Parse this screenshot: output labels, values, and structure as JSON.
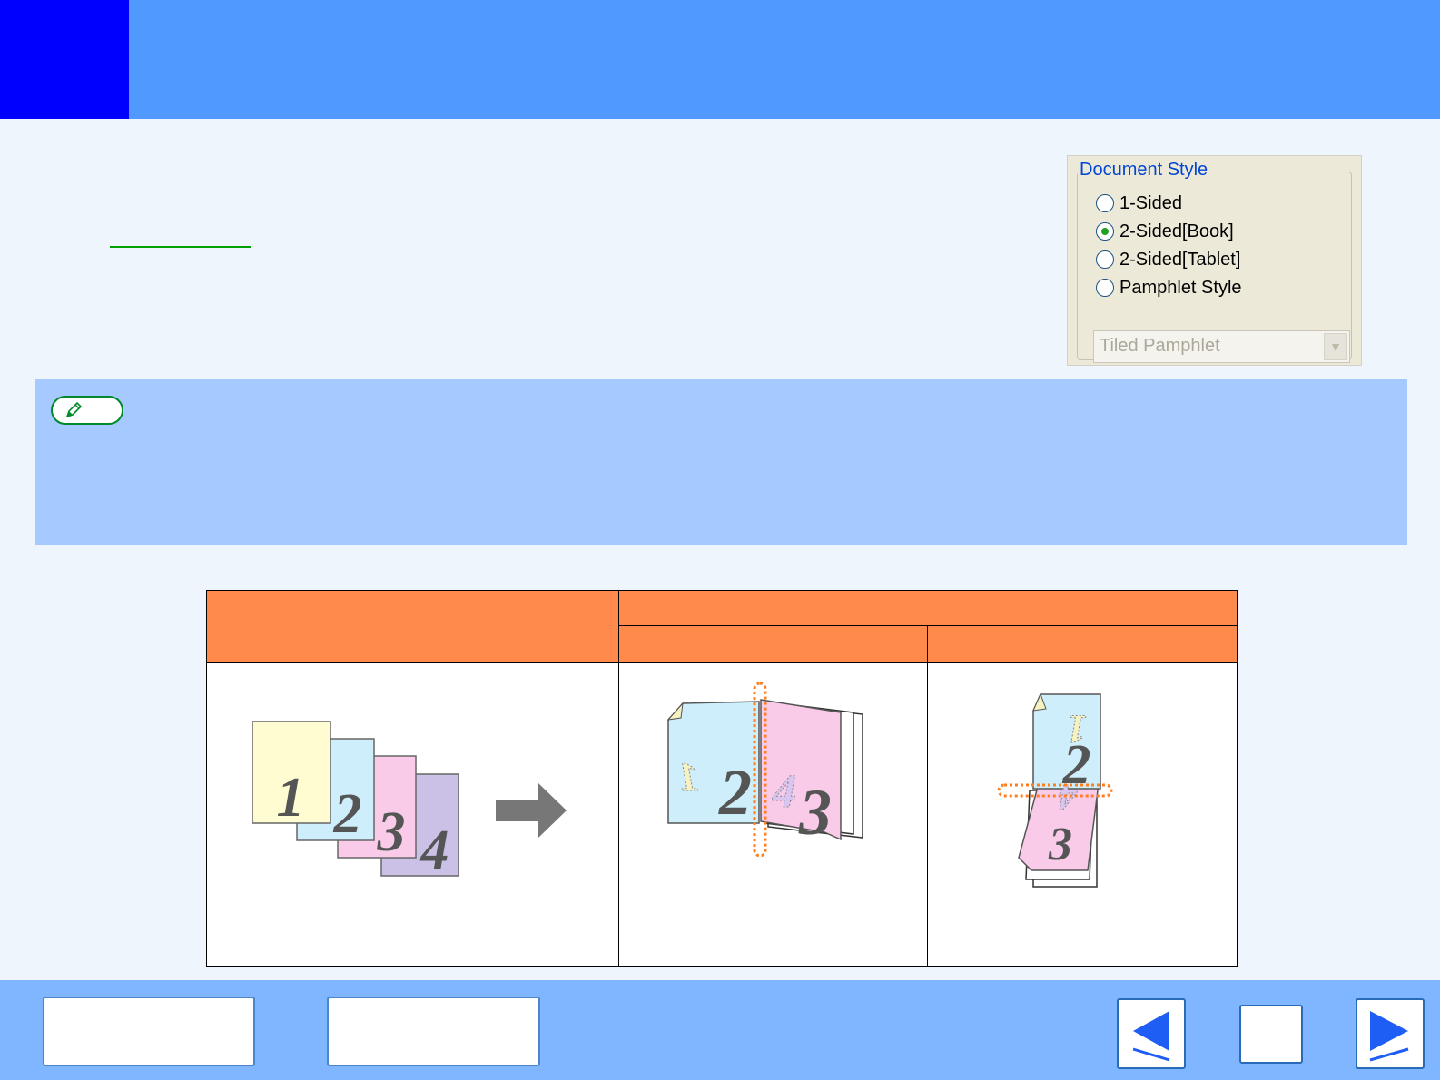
{
  "document_style": {
    "legend": "Document Style",
    "options": [
      {
        "label": "1-Sided",
        "selected": false
      },
      {
        "label": "2-Sided[Book]",
        "selected": true
      },
      {
        "label": "2-Sided[Tablet]",
        "selected": false
      },
      {
        "label": "Pamphlet Style",
        "selected": false
      }
    ],
    "pamphlet_select": {
      "value": "Tiled Pamphlet",
      "disabled": true
    }
  },
  "illustrations": {
    "original_pages": [
      "1",
      "2",
      "3",
      "4"
    ],
    "book_pages": [
      "1",
      "2",
      "4",
      "3"
    ],
    "tablet_pages": [
      "1",
      "2",
      "4",
      "3"
    ]
  },
  "colors": {
    "header": "#509aff",
    "header_block": "#0000ff",
    "note_band": "#a6caff",
    "table_header": "#ff8a4c",
    "footer": "#80b6ff"
  },
  "icons": {
    "note": "pencil-icon",
    "prev": "left-arrow-icon",
    "next": "right-arrow-icon",
    "process": "right-arrow-icon"
  }
}
